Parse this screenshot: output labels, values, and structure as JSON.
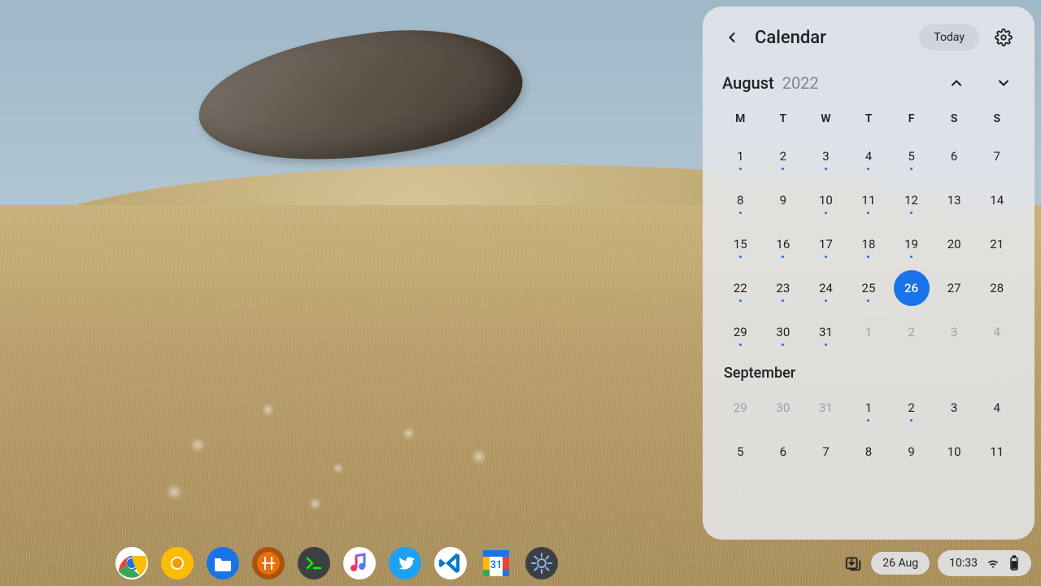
{
  "calendar": {
    "title": "Calendar",
    "today_label": "Today",
    "month": "August",
    "year": "2022",
    "weekdays": [
      "M",
      "T",
      "W",
      "T",
      "F",
      "S",
      "S"
    ],
    "next_month_label": "September",
    "days": [
      {
        "n": "1",
        "dot": true
      },
      {
        "n": "2",
        "dot": true
      },
      {
        "n": "3",
        "dot": true
      },
      {
        "n": "4",
        "dot": true
      },
      {
        "n": "5",
        "dot": true
      },
      {
        "n": "6",
        "dot": false
      },
      {
        "n": "7",
        "dot": false
      },
      {
        "n": "8",
        "dot": true
      },
      {
        "n": "9",
        "dot": false
      },
      {
        "n": "10",
        "dot": true
      },
      {
        "n": "11",
        "dot": true
      },
      {
        "n": "12",
        "dot": true
      },
      {
        "n": "13",
        "dot": false
      },
      {
        "n": "14",
        "dot": false
      },
      {
        "n": "15",
        "dot": true
      },
      {
        "n": "16",
        "dot": true
      },
      {
        "n": "17",
        "dot": true
      },
      {
        "n": "18",
        "dot": true
      },
      {
        "n": "19",
        "dot": true
      },
      {
        "n": "20",
        "dot": false
      },
      {
        "n": "21",
        "dot": false
      },
      {
        "n": "22",
        "dot": true
      },
      {
        "n": "23",
        "dot": true
      },
      {
        "n": "24",
        "dot": true
      },
      {
        "n": "25",
        "dot": true
      },
      {
        "n": "26",
        "dot": false,
        "today": true
      },
      {
        "n": "27",
        "dot": false
      },
      {
        "n": "28",
        "dot": false
      },
      {
        "n": "29",
        "dot": true
      },
      {
        "n": "30",
        "dot": true
      },
      {
        "n": "31",
        "dot": true
      },
      {
        "n": "1",
        "dot": false,
        "other": true
      },
      {
        "n": "2",
        "dot": false,
        "other": true
      },
      {
        "n": "3",
        "dot": false,
        "other": true
      },
      {
        "n": "4",
        "dot": false,
        "other": true
      }
    ],
    "sept_days": [
      {
        "n": "29",
        "other": true
      },
      {
        "n": "30",
        "other": true
      },
      {
        "n": "31",
        "other": true
      },
      {
        "n": "1",
        "dot": true
      },
      {
        "n": "2",
        "dot": true
      },
      {
        "n": "3"
      },
      {
        "n": "4"
      },
      {
        "n": "5"
      },
      {
        "n": "6"
      },
      {
        "n": "7"
      },
      {
        "n": "8"
      },
      {
        "n": "9"
      },
      {
        "n": "10"
      },
      {
        "n": "11"
      }
    ]
  },
  "shelf": {
    "apps": [
      {
        "name": "chrome",
        "color": "#fff"
      },
      {
        "name": "chrome-canary",
        "color": "#fbbc04"
      },
      {
        "name": "files",
        "color": "#1a73e8"
      },
      {
        "name": "app-orange",
        "color": "#e8710a"
      },
      {
        "name": "terminal",
        "color": "#3c4043"
      },
      {
        "name": "music",
        "color": "#fff"
      },
      {
        "name": "twitter",
        "color": "#1da1f2"
      },
      {
        "name": "vscode",
        "color": "#fff"
      },
      {
        "name": "google-calendar",
        "color": "#fff"
      },
      {
        "name": "settings",
        "color": "#3c4043"
      }
    ],
    "date_pill": "26 Aug",
    "time": "10:33"
  }
}
